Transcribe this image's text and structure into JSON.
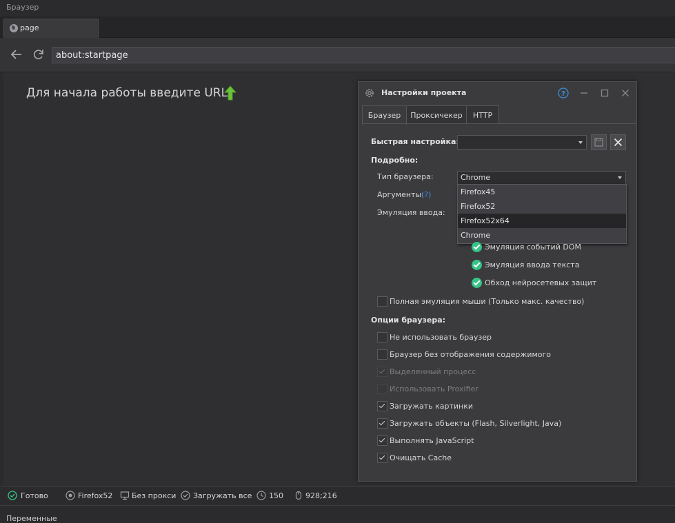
{
  "window": {
    "title": "Браузер"
  },
  "tabs": [
    {
      "label": "page"
    }
  ],
  "nav": {
    "url": "about:startpage"
  },
  "content": {
    "start_message": "Для начала работы введите URL"
  },
  "settings": {
    "title": "Настройки проекта",
    "tabs": [
      "Браузер",
      "Проксичекер",
      "HTTP"
    ],
    "quick_setup_label": "Быстрая настройка:",
    "quick_setup_value": "",
    "details_label": "Подробно:",
    "browser_type_label": "Тип браузера:",
    "browser_type_value": "Chrome",
    "browser_type_options": [
      "Firefox45",
      "Firefox52",
      "Firefox52x64",
      "Chrome"
    ],
    "highlighted_option": "Firefox52x64",
    "args_label": "Аргументы:",
    "args_help": "(?)",
    "input_emulation_label": "Эмуляция ввода:",
    "emulation_checks": [
      {
        "label": "Эмуляция событий DOM",
        "checked": true
      },
      {
        "label": "Эмуляция ввода текста",
        "checked": true
      },
      {
        "label": "Обход нейросетевых защит",
        "checked": true
      }
    ],
    "full_mouse_emulation": {
      "label": "Полная эмуляция мыши (Только макс. качество)",
      "checked": false
    },
    "browser_options_label": "Опции браузера:",
    "browser_options": [
      {
        "label": "Не использовать браузер",
        "checked": false,
        "disabled": false
      },
      {
        "label": "Браузер без отображения содержимого",
        "checked": false,
        "disabled": false
      },
      {
        "label": "Выделенный процесс",
        "checked": true,
        "disabled": true
      },
      {
        "label": "Использовать Proxifier",
        "checked": false,
        "disabled": true
      },
      {
        "label": "Загружать картинки",
        "checked": true,
        "disabled": false
      },
      {
        "label": "Загружать объекты (Flash, Silverlight, Java)",
        "checked": true,
        "disabled": false
      },
      {
        "label": "Выполнять JavaScript",
        "checked": true,
        "disabled": false
      },
      {
        "label": "Очищать Cache",
        "checked": true,
        "disabled": false
      }
    ]
  },
  "status": {
    "state": "Готово",
    "browser": "Firefox52",
    "proxy": "Без прокси",
    "load": "Загружать все",
    "timeout": "150",
    "coords": "928;216"
  },
  "bottom_panel": {
    "label": "Переменные"
  },
  "colors": {
    "accent_green": "#36c486",
    "help_blue": "#3b8fd9",
    "background": "#2b2b2e"
  }
}
